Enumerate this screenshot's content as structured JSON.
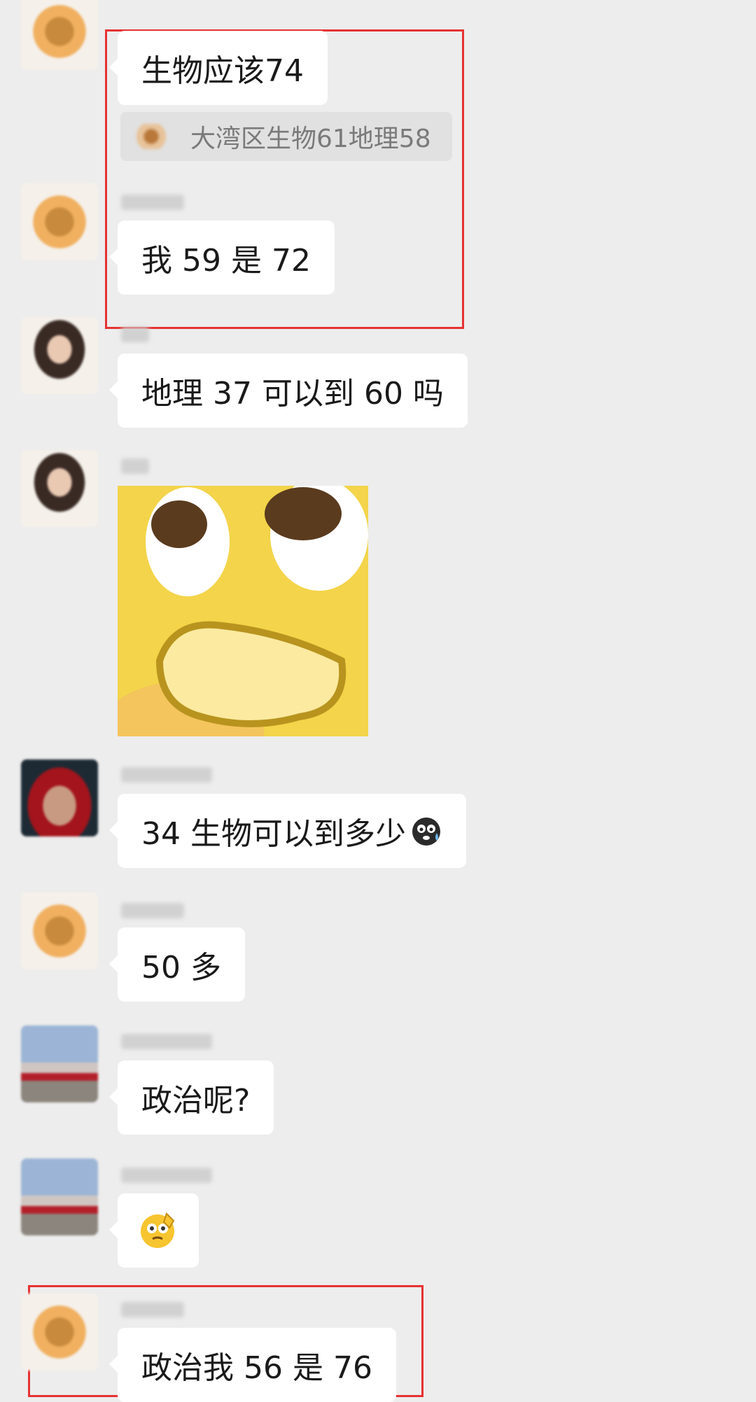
{
  "messages": [
    {
      "text": "生物应该74",
      "quote": "大湾区生物61地理58"
    },
    {
      "text": "我 59 是 72"
    },
    {
      "text": "地理 37 可以到 60 吗"
    },
    {
      "sticker": "crying-emoji-sticker"
    },
    {
      "text": "34 生物可以到多少",
      "emoji": "anxious-sweat-emoji"
    },
    {
      "text": "50 多"
    },
    {
      "text": "政治呢?"
    },
    {
      "emoji": "thinking-salute-emoji"
    },
    {
      "text": "政治我 56 是 76"
    }
  ],
  "colors": {
    "background": "#ededed",
    "bubble": "#ffffff",
    "quote_background": "#e1e1e1",
    "highlight": "#e63232"
  }
}
